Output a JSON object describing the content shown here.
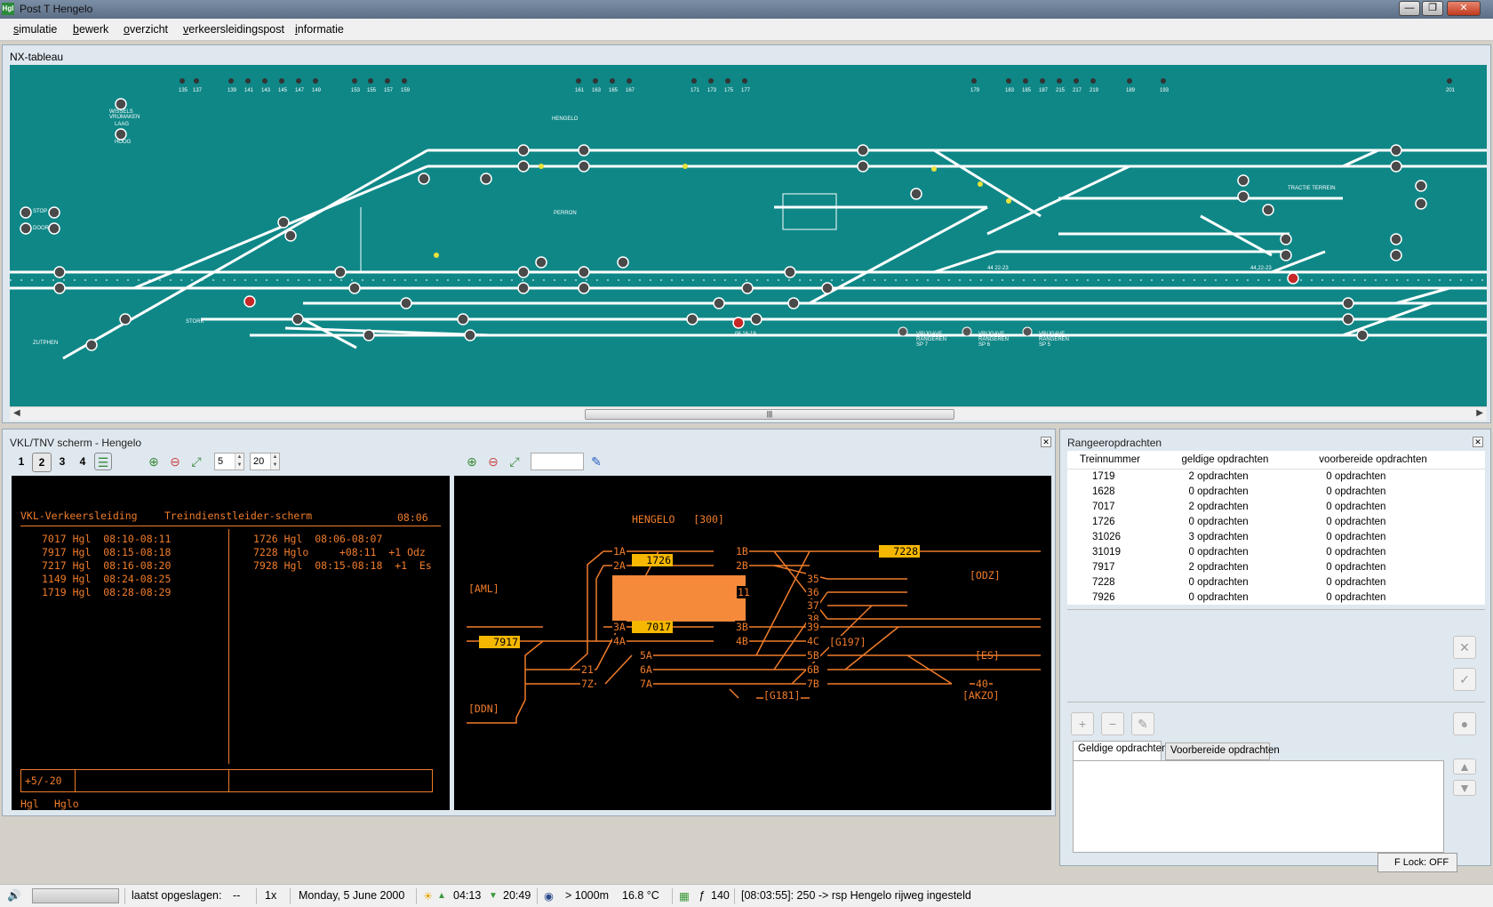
{
  "window": {
    "title": "Post T Hengelo",
    "app_icon": "Hgl"
  },
  "menu": [
    "simulatie",
    "bewerk",
    "overzicht",
    "verkeersleidingspost",
    "informatie"
  ],
  "nx": {
    "title": "NX-tableau",
    "labels": {
      "hengelo": "HENGELO",
      "perron": "PERRON",
      "zutphen": "ZUTPHEN",
      "stork": "STORK",
      "laag": "LAAG",
      "hoog": "HOOG",
      "stop": "STOP",
      "door": "DOOR",
      "wissels": "WISSELS VRIJMAKEN",
      "vrijgave1": "VRIJGAVE RANGEREN SP 7",
      "vrijgave2": "VRIJGAVE RANGEREN SP 6",
      "vrijgave3": "VRIJGAVE RANGEREN SP 5",
      "tractie": "TRACTIE TERREIN",
      "sig_a": "44 22-23",
      "sig_b": "44,22-23",
      "sig_c": "06,16-19"
    },
    "signal_numbers_top": [
      "135",
      "137",
      "139",
      "141",
      "143",
      "145",
      "147",
      "149",
      "153",
      "155",
      "157",
      "159",
      "161",
      "163",
      "165",
      "167",
      "171",
      "173",
      "175",
      "177",
      "179",
      "183",
      "185",
      "187",
      "215",
      "217",
      "219",
      "189",
      "193",
      "201"
    ]
  },
  "vkl": {
    "title": "VKL/TNV scherm - Hengelo",
    "tabs": [
      "1",
      "2",
      "3",
      "4"
    ],
    "spin1": "5",
    "spin2": "20",
    "left_screen": {
      "header_left": "VKL-Verkeersleiding",
      "header_mid": "Treindienstleider-scherm",
      "time": "08:06",
      "left_rows": [
        "7017 Hgl  08:10-08:11",
        "7917 Hgl  08:15-08:18",
        "7217 Hgl  08:16-08:20",
        "1149 Hgl  08:24-08:25",
        "1719 Hgl  08:28-08:29"
      ],
      "right_rows": [
        "1726 Hgl  08:06-08:07",
        "7228 Hglo     +08:11  +1 Odz",
        "7928 Hgl  08:15-08:18  +1  Es"
      ],
      "footer_box": "+5/-20",
      "footer_a": "Hgl",
      "footer_b": "Hglo"
    },
    "right_screen": {
      "station": "HENGELO   [300]",
      "aml": "[AML]",
      "odz": "[ODZ]",
      "es": "[ES]",
      "ddn": "[DDN]",
      "akzo": "[AKZO]",
      "g197": "[G197]",
      "g181": "[G181]",
      "tracks": [
        "1A",
        "2A",
        "3A",
        "4A",
        "5A",
        "6A",
        "7A",
        "1B",
        "2B",
        "3B",
        "4B",
        "5B",
        "6B",
        "7B",
        "11",
        "35",
        "36",
        "37",
        "38",
        "39",
        "4C",
        "21",
        "7Z",
        "40"
      ],
      "trains": {
        "t1726": "1726",
        "t7017": "7017",
        "t7228": "7228",
        "t7917": "7917"
      }
    }
  },
  "rangeer": {
    "title": "Rangeeropdrachten",
    "columns": [
      "Treinnummer",
      "geldige opdrachten",
      "voorbereide opdrachten"
    ],
    "rows": [
      [
        "1719",
        "2 opdrachten",
        "0 opdrachten"
      ],
      [
        "1628",
        "0 opdrachten",
        "0 opdrachten"
      ],
      [
        "7017",
        "2 opdrachten",
        "0 opdrachten"
      ],
      [
        "1726",
        "0 opdrachten",
        "0 opdrachten"
      ],
      [
        "31026",
        "3 opdrachten",
        "0 opdrachten"
      ],
      [
        "31019",
        "0 opdrachten",
        "0 opdrachten"
      ],
      [
        "7917",
        "2 opdrachten",
        "0 opdrachten"
      ],
      [
        "7228",
        "0 opdrachten",
        "0 opdrachten"
      ],
      [
        "7926",
        "0 opdrachten",
        "0 opdrachten"
      ]
    ],
    "tab_valid": "Geldige opdrachten",
    "tab_prepared": "Voorbereide opdrachten",
    "flock": "F Lock: OFF"
  },
  "status": {
    "saved_label": "laatst opgeslagen:",
    "saved_value": "--",
    "speed": "1x",
    "date": "Monday, 5 June 2000",
    "sunrise": "04:13",
    "sunset": "20:49",
    "visibility": "> 1000m",
    "temperature": "16.8 °C",
    "count": "140",
    "message": "[08:03:55]: 250 -> rsp Hengelo rijweg ingesteld"
  }
}
